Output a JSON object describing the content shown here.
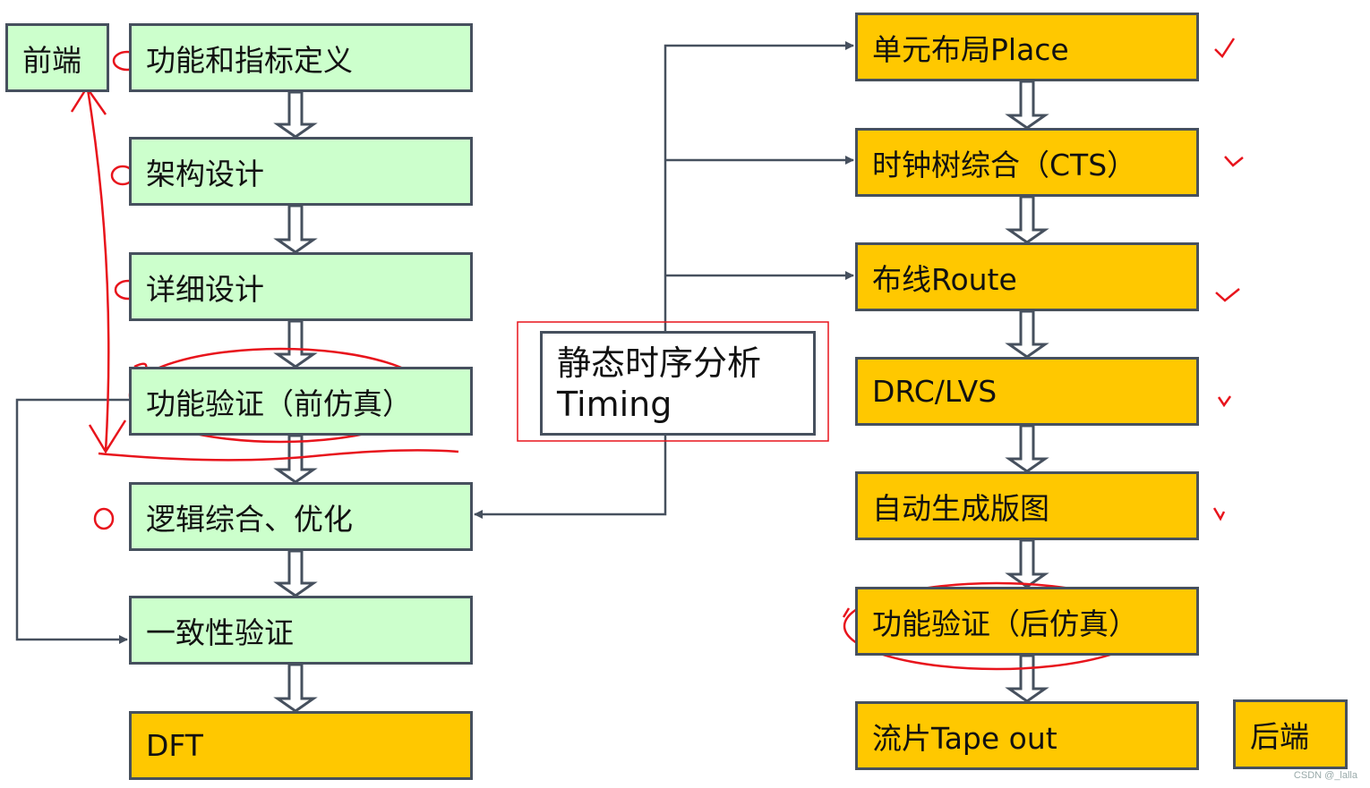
{
  "frontend_label": "前端",
  "backend_label": "后端",
  "frontend_steps": [
    "功能和指标定义",
    "架构设计",
    "详细设计",
    "功能验证（前仿真）",
    "逻辑综合、优化",
    "一致性验证",
    "DFT"
  ],
  "backend_steps": [
    "单元布局Place",
    "时钟树综合（CTS）",
    "布线Route",
    "DRC/LVS",
    "自动生成版图",
    "功能验证（后仿真）",
    "流片Tape out"
  ],
  "timing": {
    "line1": "静态时序分析",
    "line2": "Timing"
  },
  "colors": {
    "green": "#ccffcc",
    "orange": "#ffc800",
    "border": "#46505e",
    "annotation": "#e8141c"
  },
  "watermark": "CSDN @_lalla"
}
